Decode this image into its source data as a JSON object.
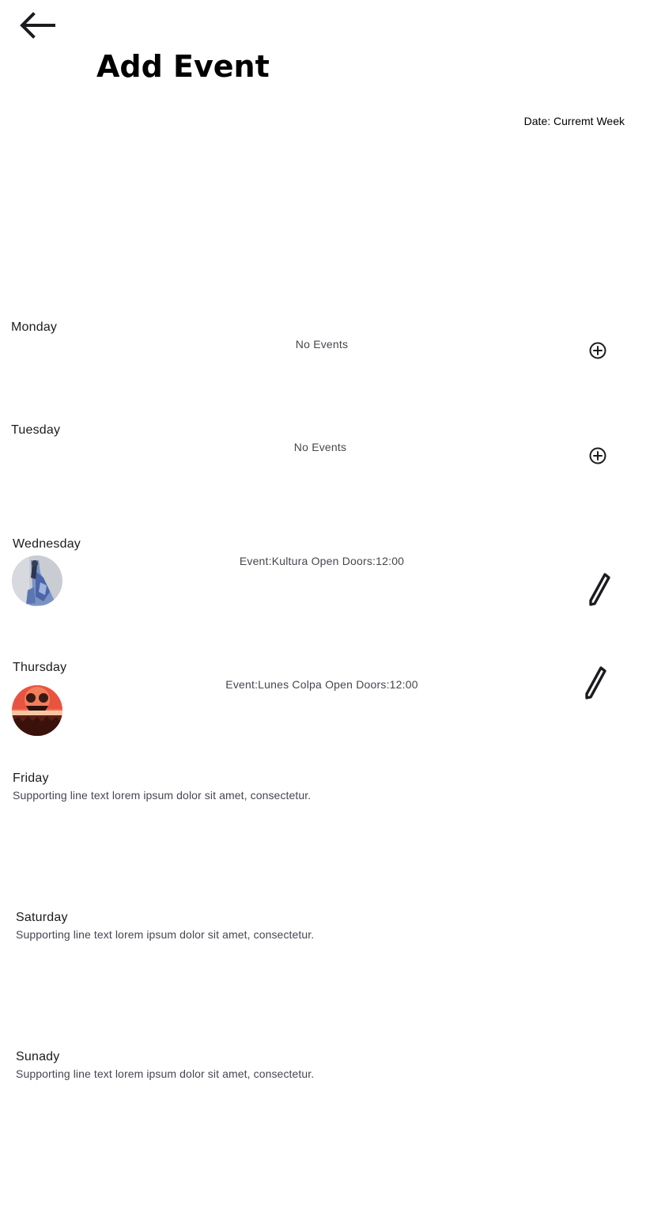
{
  "header": {
    "title": "Add Event",
    "date_label": "Date: Curremt Week"
  },
  "icons": {
    "back": "arrow-back-icon",
    "add": "add-circle-icon",
    "edit": "pencil-icon"
  },
  "days": {
    "monday": {
      "label": "Monday",
      "status": "No Events"
    },
    "tuesday": {
      "label": "Tuesday",
      "status": "No Events"
    },
    "wednesday": {
      "label": "Wednesday",
      "event": "Event:Kultura  Open Doors:12:00"
    },
    "thursday": {
      "label": "Thursday",
      "event": "Event:Lunes Colpa  Open Doors:12:00"
    },
    "friday": {
      "label": "Friday",
      "supporting": "Supporting line text lorem ipsum dolor sit amet, consectetur."
    },
    "saturday": {
      "label": "Saturday",
      "supporting": "Supporting line text lorem ipsum dolor sit amet, consectetur."
    },
    "sunday": {
      "label": "Sunady",
      "supporting": "Supporting line text lorem ipsum dolor sit amet, consectetur."
    }
  }
}
